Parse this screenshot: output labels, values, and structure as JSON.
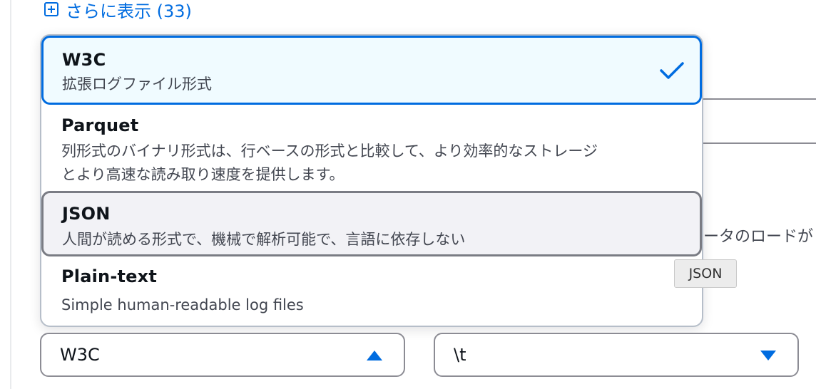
{
  "show_more": {
    "label": "さらに表示 (33)"
  },
  "background": {
    "partial_text": "ータのロードが"
  },
  "menu": {
    "options": [
      {
        "title": "W3C",
        "description": "拡張ログファイル形式",
        "selected": true
      },
      {
        "title": "Parquet",
        "description_line1": "列形式のバイナリ形式は、行ベースの形式と比較して、より効率的なストレージ",
        "description_line2": "とより高速な読み取り速度を提供します。"
      },
      {
        "title": "JSON",
        "description": "人間が読める形式で、機械で解析可能で、言語に依存しない",
        "hovered": true
      },
      {
        "title": "Plain-text",
        "description": "Simple human-readable log files"
      }
    ]
  },
  "tooltip": {
    "text": "JSON"
  },
  "format_select": {
    "value": "W3C",
    "icon": "caret-up-icon"
  },
  "delimiter_select": {
    "value": "\\t",
    "icon": "caret-down-icon"
  },
  "colors": {
    "accent": "#006ce0",
    "selected_bg": "#f0fbff",
    "hover_bg": "#f2f2f6"
  }
}
